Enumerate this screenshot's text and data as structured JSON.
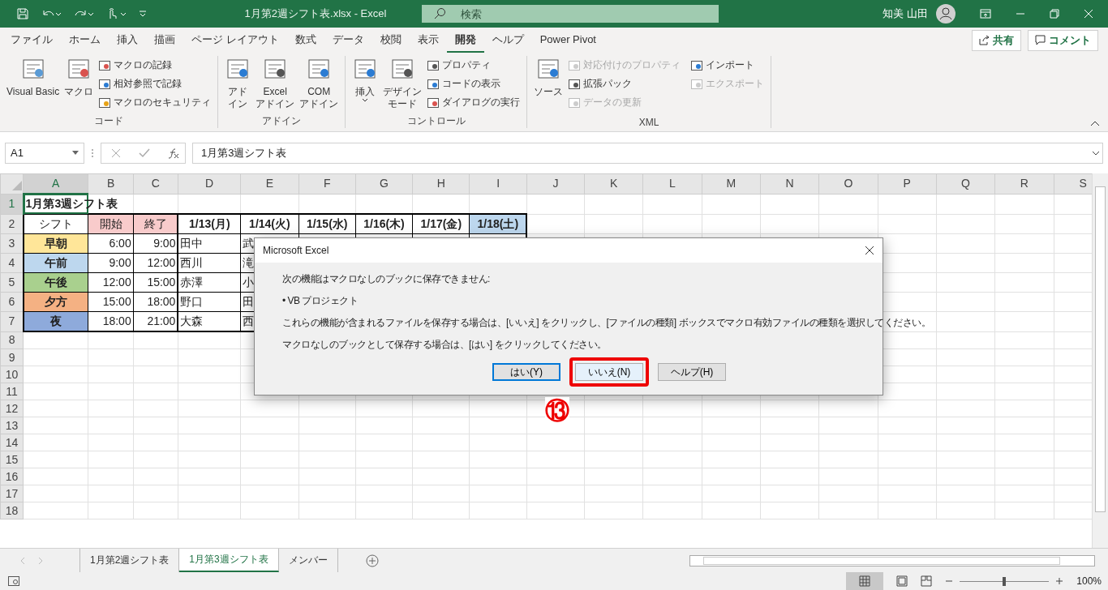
{
  "window": {
    "title": "1月第2週シフト表.xlsx  -  Excel",
    "search": {
      "placeholder": "検索"
    },
    "user": "知美 山田"
  },
  "tabs": [
    {
      "label": "ファイル",
      "selected": false
    },
    {
      "label": "ホーム",
      "selected": false
    },
    {
      "label": "挿入",
      "selected": false
    },
    {
      "label": "描画",
      "selected": false
    },
    {
      "label": "ページ レイアウト",
      "selected": false
    },
    {
      "label": "数式",
      "selected": false
    },
    {
      "label": "データ",
      "selected": false
    },
    {
      "label": "校閲",
      "selected": false
    },
    {
      "label": "表示",
      "selected": false
    },
    {
      "label": "開発",
      "selected": true
    },
    {
      "label": "ヘルプ",
      "selected": false
    },
    {
      "label": "Power Pivot",
      "selected": false
    }
  ],
  "share_button": "共有",
  "comment_button": "コメント",
  "ribbon": {
    "groups": [
      {
        "label": "コード",
        "large": [
          {
            "lines": [
              "Visual Basic"
            ],
            "dropdown": false
          },
          {
            "lines": [
              "マクロ"
            ],
            "dropdown": false
          }
        ],
        "small": [
          {
            "label": "マクロの記録",
            "disabled": false
          },
          {
            "label": "相対参照で記録",
            "disabled": false
          },
          {
            "label": "マクロのセキュリティ",
            "disabled": false
          }
        ]
      },
      {
        "label": "アドイン",
        "large": [
          {
            "lines": [
              "アド",
              "イン"
            ],
            "dropdown": false
          },
          {
            "lines": [
              "Excel",
              "アドイン"
            ],
            "dropdown": false
          },
          {
            "lines": [
              "COM",
              "アドイン"
            ],
            "dropdown": false
          }
        ]
      },
      {
        "label": "コントロール",
        "large": [
          {
            "lines": [
              "挿入"
            ],
            "dropdown": true
          },
          {
            "lines": [
              "デザイン",
              "モード"
            ],
            "dropdown": false
          }
        ],
        "small": [
          {
            "label": "プロパティ",
            "disabled": false
          },
          {
            "label": "コードの表示",
            "disabled": false
          },
          {
            "label": "ダイアログの実行",
            "disabled": false
          }
        ]
      },
      {
        "label": "XML",
        "large": [
          {
            "lines": [
              "ソース"
            ],
            "dropdown": false
          }
        ],
        "small": [
          {
            "label": "対応付けのプロパティ",
            "disabled": true
          },
          {
            "label": "拡張パック",
            "disabled": false
          },
          {
            "label": "データの更新",
            "disabled": true
          },
          {
            "label": "インポート",
            "disabled": false
          },
          {
            "label": "エクスポート",
            "disabled": true
          }
        ]
      }
    ]
  },
  "formula_bar": {
    "name_box": "A1",
    "formula": "1月第3週シフト表"
  },
  "columns": [
    {
      "label": "A",
      "selected": true
    },
    {
      "label": "B",
      "selected": false
    },
    {
      "label": "C",
      "selected": false
    },
    {
      "label": "D",
      "selected": false
    },
    {
      "label": "E",
      "selected": false
    },
    {
      "label": "F",
      "selected": false
    },
    {
      "label": "G",
      "selected": false
    },
    {
      "label": "H",
      "selected": false
    },
    {
      "label": "I",
      "selected": false
    },
    {
      "label": "J",
      "selected": false
    },
    {
      "label": "K",
      "selected": false
    },
    {
      "label": "L",
      "selected": false
    },
    {
      "label": "M",
      "selected": false
    },
    {
      "label": "N",
      "selected": false
    },
    {
      "label": "O",
      "selected": false
    },
    {
      "label": "P",
      "selected": false
    },
    {
      "label": "Q",
      "selected": false
    },
    {
      "label": "R",
      "selected": false
    },
    {
      "label": "S",
      "selected": false
    }
  ],
  "rows": [
    {
      "number": "1",
      "selected": true,
      "cells": [
        {
          "text": "1月第3週シフト表",
          "kind": "title"
        }
      ]
    },
    {
      "number": "2",
      "selected": false,
      "cells": [
        {
          "text": "シフト",
          "kind": "header"
        },
        {
          "text": "開始",
          "kind": "header",
          "color": "#f8cbcb"
        },
        {
          "text": "終了",
          "kind": "header",
          "color": "#f8cbcb"
        },
        {
          "text": "1/13(月)",
          "kind": "date"
        },
        {
          "text": "1/14(火)",
          "kind": "date"
        },
        {
          "text": "1/15(水)",
          "kind": "date"
        },
        {
          "text": "1/16(木)",
          "kind": "date"
        },
        {
          "text": "1/17(金)",
          "kind": "date"
        },
        {
          "text": "1/18(土)",
          "kind": "date",
          "color": "#bdd7ee"
        }
      ]
    },
    {
      "number": "3",
      "selected": false,
      "cells": [
        {
          "text": "早朝",
          "kind": "shift",
          "color": "#ffe699"
        },
        {
          "text": "6:00",
          "kind": "time"
        },
        {
          "text": "9:00",
          "kind": "time"
        },
        {
          "text": "田中",
          "kind": "name"
        },
        {
          "text": "武",
          "kind": "name"
        }
      ]
    },
    {
      "number": "4",
      "selected": false,
      "cells": [
        {
          "text": "午前",
          "kind": "shift",
          "color": "#bdd7ee"
        },
        {
          "text": "9:00",
          "kind": "time"
        },
        {
          "text": "12:00",
          "kind": "time"
        },
        {
          "text": "西川",
          "kind": "name"
        },
        {
          "text": "滝",
          "kind": "name"
        }
      ]
    },
    {
      "number": "5",
      "selected": false,
      "cells": [
        {
          "text": "午後",
          "kind": "shift",
          "color": "#a9d08e"
        },
        {
          "text": "12:00",
          "kind": "time"
        },
        {
          "text": "15:00",
          "kind": "time"
        },
        {
          "text": "赤澤",
          "kind": "name"
        },
        {
          "text": "小",
          "kind": "name"
        }
      ]
    },
    {
      "number": "6",
      "selected": false,
      "cells": [
        {
          "text": "夕方",
          "kind": "shift",
          "color": "#f4b183"
        },
        {
          "text": "15:00",
          "kind": "time"
        },
        {
          "text": "18:00",
          "kind": "time"
        },
        {
          "text": "野口",
          "kind": "name"
        },
        {
          "text": "田",
          "kind": "name"
        }
      ]
    },
    {
      "number": "7",
      "selected": false,
      "cells": [
        {
          "text": "夜",
          "kind": "shift",
          "color": "#8eaadb"
        },
        {
          "text": "18:00",
          "kind": "time"
        },
        {
          "text": "21:00",
          "kind": "time"
        },
        {
          "text": "大森",
          "kind": "name"
        },
        {
          "text": "西",
          "kind": "name"
        }
      ]
    },
    {
      "number": "8",
      "selected": false,
      "cells": []
    },
    {
      "number": "9",
      "selected": false,
      "cells": []
    },
    {
      "number": "10",
      "selected": false,
      "cells": []
    },
    {
      "number": "11",
      "selected": false,
      "cells": []
    },
    {
      "number": "12",
      "selected": false,
      "cells": []
    },
    {
      "number": "13",
      "selected": false,
      "cells": []
    },
    {
      "number": "14",
      "selected": false,
      "cells": []
    },
    {
      "number": "15",
      "selected": false,
      "cells": []
    },
    {
      "number": "16",
      "selected": false,
      "cells": []
    },
    {
      "number": "17",
      "selected": false,
      "cells": []
    },
    {
      "number": "18",
      "selected": false,
      "cells": []
    }
  ],
  "dialog": {
    "title": "Microsoft Excel",
    "messages": [
      "次の機能はマクロなしのブックに保存できません:",
      "• VB プロジェクト",
      "これらの機能が含まれるファイルを保存する場合は、[いいえ] をクリックし、[ファイルの種類] ボックスでマクロ有効ファイルの種類を選択してください。",
      "マクロなしのブックとして保存する場合は、[はい] をクリックしてください。"
    ],
    "buttons": [
      {
        "label": "はい(Y)",
        "default": true,
        "highlighted": false
      },
      {
        "label": "いいえ(N)",
        "default": false,
        "highlighted": true
      },
      {
        "label": "ヘルプ(H)",
        "default": false,
        "highlighted": false
      }
    ],
    "callout": "⑬"
  },
  "sheet_tabs": [
    {
      "label": "1月第2週シフト表",
      "selected": false
    },
    {
      "label": "1月第3週シフト表",
      "selected": true
    },
    {
      "label": "メンバー",
      "selected": false
    }
  ],
  "status_bar": {
    "zoom": {
      "level": 0.5,
      "reading": "100%"
    }
  }
}
